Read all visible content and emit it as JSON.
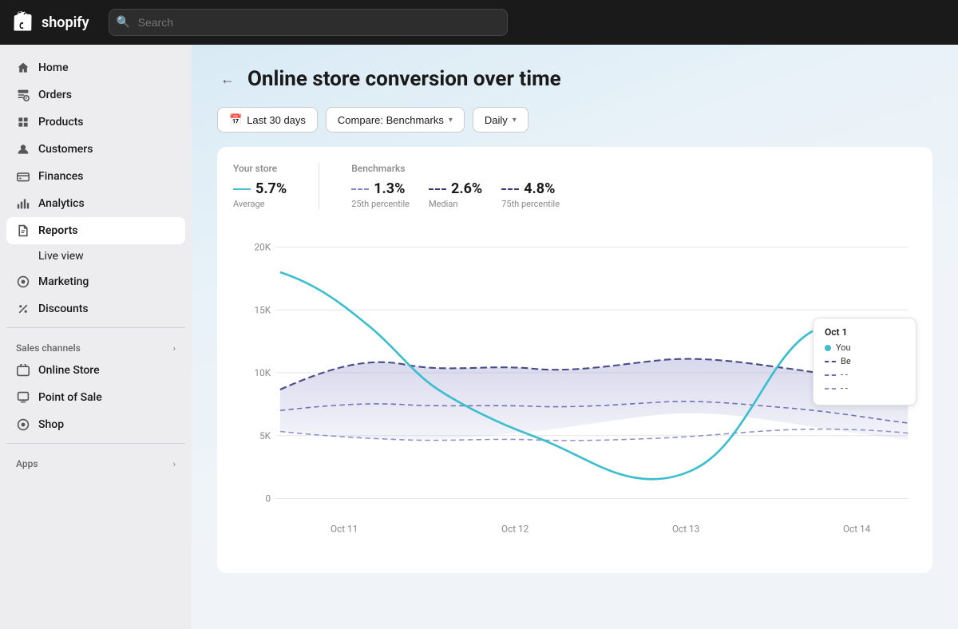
{
  "topNav": {
    "brand": "shopify",
    "searchPlaceholder": "Search"
  },
  "sidebar": {
    "items": [
      {
        "id": "home",
        "label": "Home",
        "icon": "home",
        "active": false
      },
      {
        "id": "orders",
        "label": "Orders",
        "icon": "orders",
        "active": false
      },
      {
        "id": "products",
        "label": "Products",
        "icon": "products",
        "active": false
      },
      {
        "id": "customers",
        "label": "Customers",
        "icon": "customers",
        "active": false
      },
      {
        "id": "finances",
        "label": "Finances",
        "icon": "finances",
        "active": false
      },
      {
        "id": "analytics",
        "label": "Analytics",
        "icon": "analytics",
        "active": false
      },
      {
        "id": "reports",
        "label": "Reports",
        "icon": "reports",
        "active": true
      },
      {
        "id": "live-view",
        "label": "Live view",
        "icon": "",
        "active": false,
        "sub": true
      },
      {
        "id": "marketing",
        "label": "Marketing",
        "icon": "marketing",
        "active": false
      },
      {
        "id": "discounts",
        "label": "Discounts",
        "icon": "discounts",
        "active": false
      }
    ],
    "salesChannelsLabel": "Sales channels",
    "salesChannels": [
      {
        "id": "online-store",
        "label": "Online Store"
      },
      {
        "id": "point-of-sale",
        "label": "Point of Sale"
      },
      {
        "id": "shop",
        "label": "Shop"
      }
    ],
    "appsLabel": "Apps"
  },
  "page": {
    "title": "Online store conversion over time",
    "backLabel": "←"
  },
  "filters": {
    "dateRange": "Last 30 days",
    "compare": "Compare: Benchmarks",
    "interval": "Daily"
  },
  "chart": {
    "yourStoreLabel": "Your store",
    "benchmarksLabel": "Benchmarks",
    "metrics": [
      {
        "id": "average",
        "value": "5.7%",
        "label": "Average",
        "lineType": "solid"
      },
      {
        "id": "p25",
        "value": "1.3%",
        "label": "25th percentile",
        "lineType": "dashed-light"
      },
      {
        "id": "median",
        "value": "2.6%",
        "label": "Median",
        "lineType": "dashed-med"
      },
      {
        "id": "p75",
        "value": "4.8%",
        "label": "75th percentile",
        "lineType": "dashed-dark"
      }
    ],
    "yAxis": [
      "20K",
      "15K",
      "10K",
      "5K",
      "0"
    ],
    "xAxis": [
      "Oct 11",
      "Oct 12",
      "Oct 13",
      "Oct 14"
    ],
    "tooltip": {
      "date": "Oct 1",
      "yourStoreLabel": "You",
      "benchmarkLabel": "Be",
      "rows": [
        {
          "type": "solid-cyan",
          "text": "—"
        },
        {
          "type": "dashed-dark",
          "text": "- -"
        },
        {
          "type": "dashed-med",
          "text": "- -"
        },
        {
          "type": "dashed-light",
          "text": "- -"
        }
      ]
    }
  }
}
